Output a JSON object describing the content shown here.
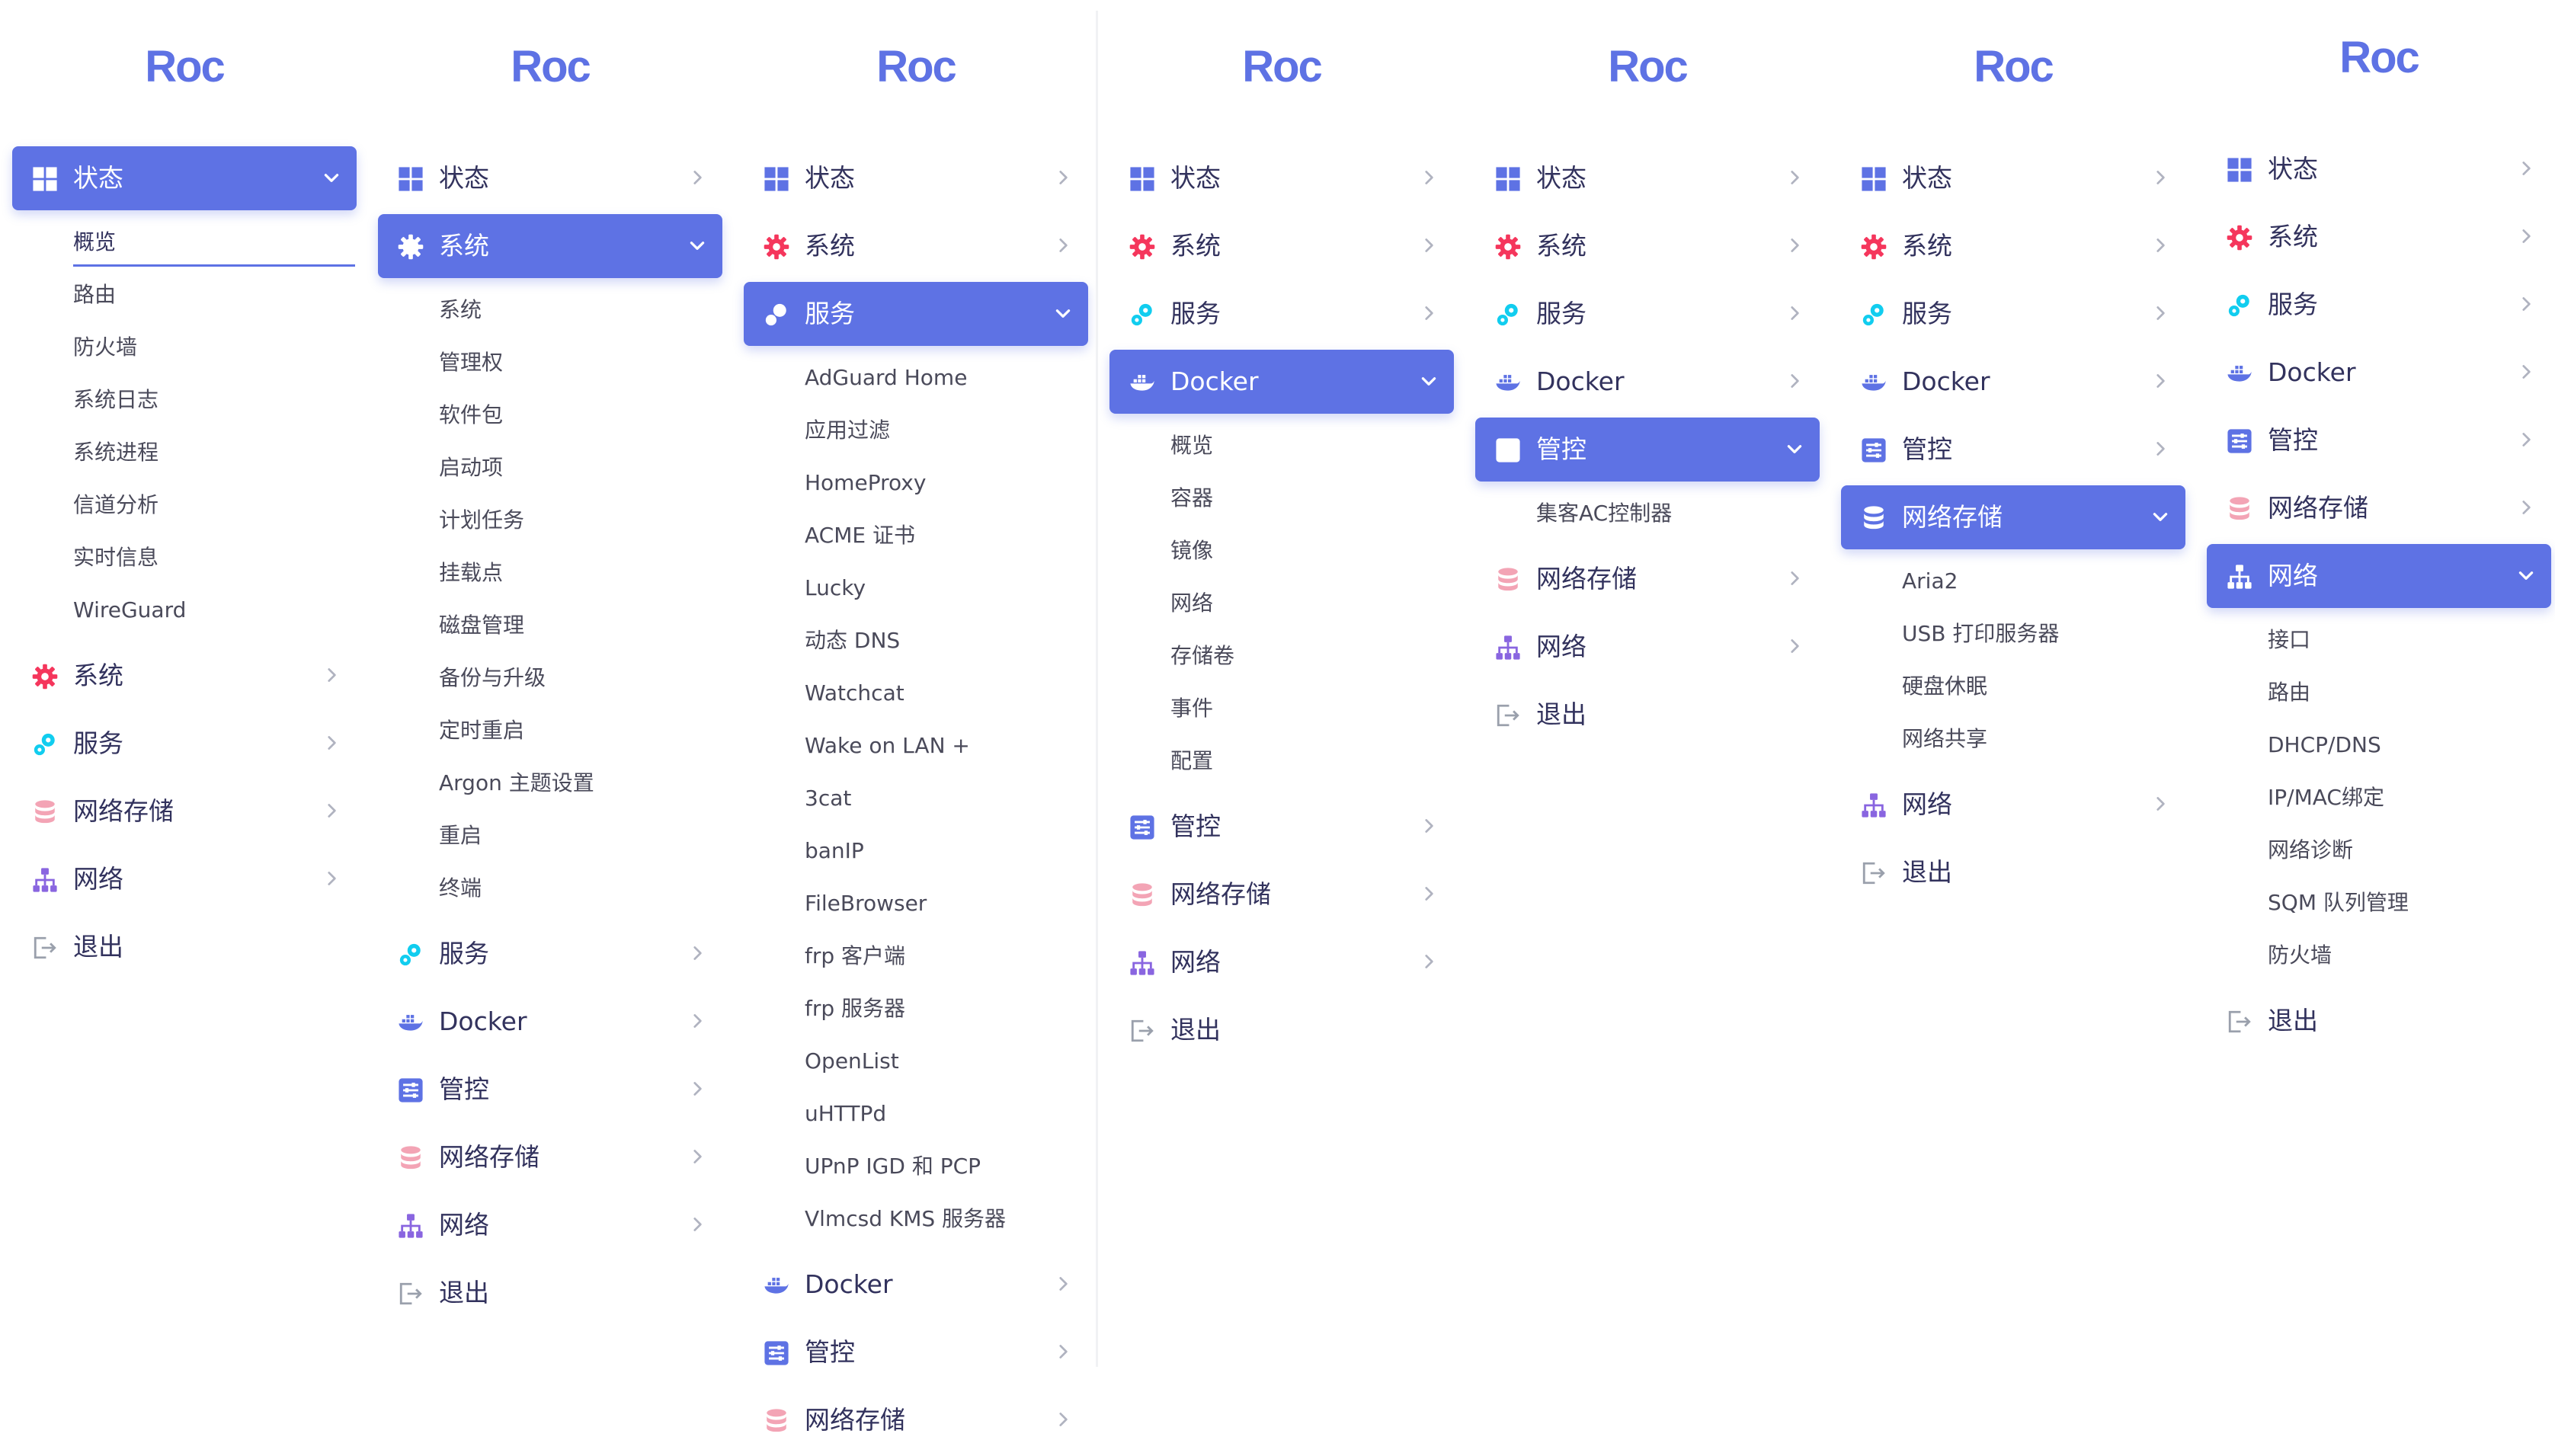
{
  "logo": "Roc",
  "colors": {
    "accent": "#5e72e4",
    "text": "#32325d",
    "background": "#ffffff"
  },
  "labels": {
    "status": "状态",
    "system": "系统",
    "services": "服务",
    "docker": "Docker",
    "control": "管控",
    "nas": "网络存储",
    "network": "网络",
    "logout": "退出"
  },
  "panels": [
    {
      "expanded": "status",
      "order": [
        "status",
        "system",
        "services",
        "nas",
        "network",
        "logout"
      ],
      "submenu": [
        "概览",
        "路由",
        "防火墙",
        "系统日志",
        "系统进程",
        "信道分析",
        "实时信息",
        "WireGuard"
      ],
      "current_subitem": "概览"
    },
    {
      "expanded": "system",
      "order": [
        "status",
        "system",
        "services",
        "docker",
        "control",
        "nas",
        "network",
        "logout"
      ],
      "submenu": [
        "系统",
        "管理权",
        "软件包",
        "启动项",
        "计划任务",
        "挂载点",
        "磁盘管理",
        "备份与升级",
        "定时重启",
        "Argon 主题设置",
        "重启",
        "终端"
      ]
    },
    {
      "expanded": "services",
      "order": [
        "status",
        "system",
        "services",
        "docker",
        "control",
        "nas"
      ],
      "submenu": [
        "AdGuard Home",
        "应用过滤",
        "HomeProxy",
        "ACME 证书",
        "Lucky",
        "动态 DNS",
        "Watchcat",
        "Wake on LAN +",
        "3cat",
        "banIP",
        "FileBrowser",
        "frp 客户端",
        "frp 服务器",
        "OpenList",
        "uHTTPd",
        "UPnP IGD 和 PCP",
        "Vlmcsd KMS 服务器"
      ]
    },
    {
      "expanded": "docker",
      "order": [
        "status",
        "system",
        "services",
        "docker",
        "control",
        "nas",
        "network",
        "logout"
      ],
      "submenu": [
        "概览",
        "容器",
        "镜像",
        "网络",
        "存储卷",
        "事件",
        "配置"
      ]
    },
    {
      "expanded": "control",
      "order": [
        "status",
        "system",
        "services",
        "docker",
        "control",
        "nas",
        "network",
        "logout"
      ],
      "submenu": [
        "集客AC控制器"
      ]
    },
    {
      "expanded": "nas",
      "order": [
        "status",
        "system",
        "services",
        "docker",
        "control",
        "nas",
        "network",
        "logout"
      ],
      "submenu": [
        "Aria2",
        "USB 打印服务器",
        "硬盘休眠",
        "网络共享"
      ]
    },
    {
      "expanded": "network",
      "order": [
        "status",
        "system",
        "services",
        "docker",
        "control",
        "nas",
        "network",
        "logout"
      ],
      "submenu": [
        "接口",
        "路由",
        "DHCP/DNS",
        "IP/MAC绑定",
        "网络诊断",
        "SQM 队列管理",
        "防火墙"
      ]
    }
  ],
  "icons": {
    "status": "dashboard-grid-icon",
    "system": "gear-icon",
    "services": "gears-icon",
    "docker": "docker-whale-icon",
    "control": "sliders-icon",
    "nas": "database-icon",
    "network": "sitemap-icon",
    "logout": "logout-icon"
  }
}
